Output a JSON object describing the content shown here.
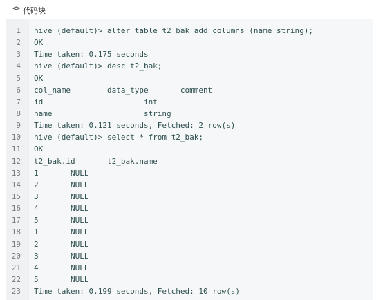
{
  "header": {
    "icon": "<>",
    "label": "代码块"
  },
  "code": {
    "line_numbers": [
      "1",
      "2",
      "3",
      "4",
      "5",
      "6",
      "7",
      "8",
      "9",
      "10",
      "11",
      "12",
      "13",
      "14",
      "15",
      "16",
      "17",
      "18",
      "19",
      "20",
      "21",
      "22",
      "23"
    ],
    "lines": [
      "hive (default)> alter table t2_bak add columns (name string);",
      "OK",
      "Time taken: 0.175 seconds",
      "hive (default)> desc t2_bak;",
      "OK",
      "col_name\tdata_type\tcomment",
      "id\t\t\tint",
      "name\t\t\tstring",
      "Time taken: 0.121 seconds, Fetched: 2 row(s)",
      "hive (default)> select * from t2_bak;",
      "OK",
      "t2_bak.id\tt2_bak.name",
      "1\tNULL",
      "2\tNULL",
      "3\tNULL",
      "4\tNULL",
      "5\tNULL",
      "1\tNULL",
      "2\tNULL",
      "3\tNULL",
      "4\tNULL",
      "5\tNULL",
      "Time taken: 0.199 seconds, Fetched: 10 row(s)"
    ]
  }
}
